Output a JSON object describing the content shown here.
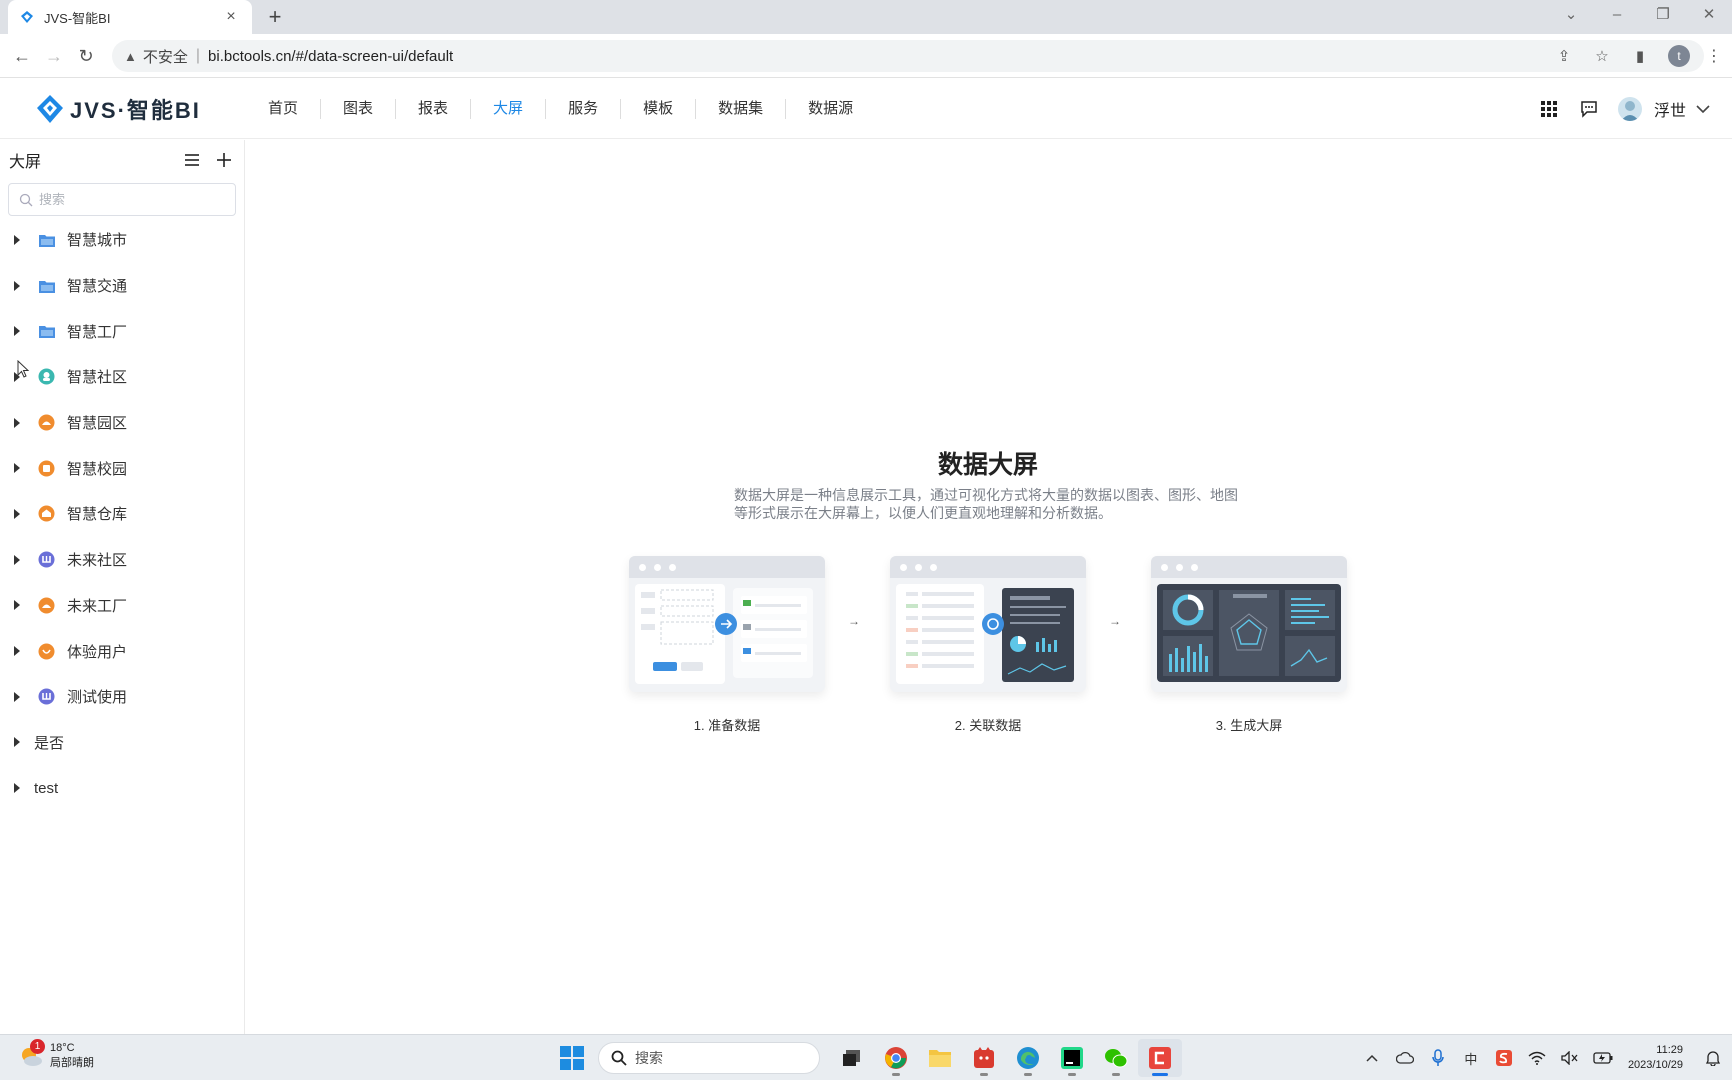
{
  "browser": {
    "tab_title": "JVS-智能BI",
    "tab_close": "×",
    "new_tab": "+",
    "security_label": "不安全",
    "url": "bi.bctools.cn/#/data-screen-ui/default",
    "profile_initial": "t"
  },
  "app": {
    "logo_text": "JVS·智能BI",
    "nav": [
      {
        "label": "首页",
        "active": false
      },
      {
        "label": "图表",
        "active": false
      },
      {
        "label": "报表",
        "active": false
      },
      {
        "label": "大屏",
        "active": true
      },
      {
        "label": "服务",
        "active": false
      },
      {
        "label": "模板",
        "active": false
      },
      {
        "label": "数据集",
        "active": false
      },
      {
        "label": "数据源",
        "active": false
      }
    ],
    "user_name": "浮世",
    "accent_color": "#1e88e5"
  },
  "sidebar": {
    "title": "大屏",
    "search_placeholder": "搜索",
    "items": [
      {
        "label": "智慧城市",
        "icon": "folder-icon",
        "color": "#4a90e2"
      },
      {
        "label": "智慧交通",
        "icon": "folder-icon",
        "color": "#4a90e2"
      },
      {
        "label": "智慧工厂",
        "icon": "folder-icon",
        "color": "#4a90e2"
      },
      {
        "label": "智慧社区",
        "icon": "circle-icon",
        "color": "#3bb8b0"
      },
      {
        "label": "智慧园区",
        "icon": "circle-icon",
        "color": "#f08c2e"
      },
      {
        "label": "智慧校园",
        "icon": "circle-icon",
        "color": "#f08c2e"
      },
      {
        "label": "智慧仓库",
        "icon": "circle-icon",
        "color": "#f08c2e"
      },
      {
        "label": "未来社区",
        "icon": "circle-icon",
        "color": "#6a6fd8"
      },
      {
        "label": "未来工厂",
        "icon": "circle-icon",
        "color": "#f08c2e"
      },
      {
        "label": "体验用户",
        "icon": "circle-icon",
        "color": "#f08c2e"
      },
      {
        "label": "测试使用",
        "icon": "circle-icon",
        "color": "#6a6fd8"
      },
      {
        "label": "是否",
        "icon": "",
        "color": ""
      },
      {
        "label": "test",
        "icon": "",
        "color": ""
      }
    ]
  },
  "main": {
    "title": "数据大屏",
    "description": "数据大屏是一种信息展示工具，通过可视化方式将大量的数据以图表、图形、地图等形式展示在大屏幕上，以便人们更直观地理解和分析数据。",
    "steps": [
      {
        "label": "1. 准备数据"
      },
      {
        "label": "2. 关联数据"
      },
      {
        "label": "3. 生成大屏"
      }
    ],
    "step_arrow": "→"
  },
  "taskbar": {
    "temperature": "18°C",
    "weather": "局部晴朗",
    "weather_badge": "1",
    "search_label": "搜索",
    "ime_label": "中",
    "time": "11:29",
    "date": "2023/10/29"
  }
}
